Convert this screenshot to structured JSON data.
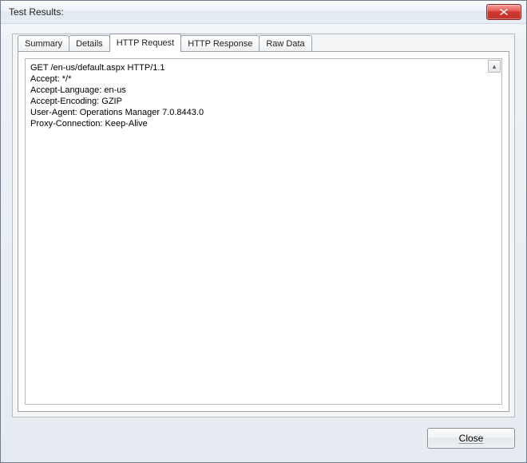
{
  "window": {
    "title": "Test Results:"
  },
  "tabs": {
    "summary": "Summary",
    "details": "Details",
    "http_request": "HTTP Request",
    "http_response": "HTTP Response",
    "raw_data": "Raw Data",
    "active": "http_request"
  },
  "http_request_body": "GET /en-us/default.aspx HTTP/1.1\nAccept: */*\nAccept-Language: en-us\nAccept-Encoding: GZIP\nUser-Agent: Operations Manager 7.0.8443.0\nProxy-Connection: Keep-Alive\n",
  "footer": {
    "close_label": "Close"
  }
}
